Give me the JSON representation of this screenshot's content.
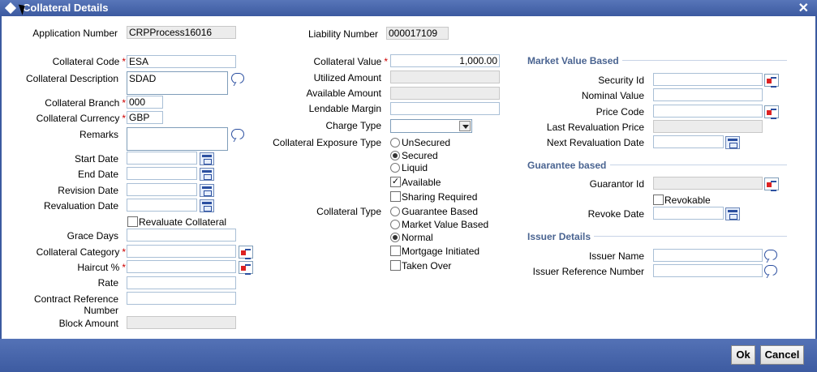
{
  "window": {
    "title": "Collateral Details",
    "close_glyph": "✕"
  },
  "left": {
    "application_number": {
      "label": "Application Number",
      "value": "CRPProcess16016"
    },
    "collateral_code": {
      "label": "Collateral Code",
      "value": "ESA"
    },
    "collateral_description": {
      "label": "Collateral Description",
      "value": "SDAD"
    },
    "collateral_branch": {
      "label": "Collateral Branch",
      "value": "000"
    },
    "collateral_currency": {
      "label": "Collateral Currency",
      "value": "GBP"
    },
    "remarks": {
      "label": "Remarks",
      "value": ""
    },
    "start_date": {
      "label": "Start Date",
      "value": ""
    },
    "end_date": {
      "label": "End Date",
      "value": ""
    },
    "revision_date": {
      "label": "Revision Date",
      "value": ""
    },
    "revaluation_date": {
      "label": "Revaluation Date",
      "value": ""
    },
    "revaluate_collateral": {
      "label": "Revaluate Collateral",
      "checked": false
    },
    "grace_days": {
      "label": "Grace Days",
      "value": ""
    },
    "collateral_category": {
      "label": "Collateral Category",
      "value": ""
    },
    "haircut": {
      "label": "Haircut %",
      "value": ""
    },
    "rate": {
      "label": "Rate",
      "value": ""
    },
    "contract_reference_number": {
      "label_line1": "Contract Reference",
      "label_line2": "Number",
      "value": ""
    },
    "block_amount": {
      "label": "Block Amount",
      "value": ""
    },
    "required_mark": "*"
  },
  "middle": {
    "liability_number": {
      "label": "Liability Number",
      "value": "000017109"
    },
    "collateral_value": {
      "label": "Collateral Value",
      "value": "1,000.00"
    },
    "utilized_amount": {
      "label": "Utilized Amount",
      "value": ""
    },
    "available_amount": {
      "label": "Available Amount",
      "value": ""
    },
    "lendable_margin": {
      "label": "Lendable Margin",
      "value": ""
    },
    "charge_type": {
      "label": "Charge Type",
      "value": ""
    },
    "exposure_type": {
      "label": "Collateral Exposure Type",
      "options": [
        "UnSecured",
        "Secured",
        "Liquid"
      ],
      "selected": "Secured"
    },
    "available": {
      "label": "Available",
      "checked": true
    },
    "sharing_required": {
      "label": "Sharing Required",
      "checked": false
    },
    "collateral_type": {
      "label": "Collateral Type",
      "options": [
        "Guarantee Based",
        "Market Value Based",
        "Normal"
      ],
      "selected": "Normal"
    },
    "mortgage_initiated": {
      "label": "Mortgage Initiated",
      "checked": false
    },
    "taken_over": {
      "label": "Taken Over",
      "checked": false
    },
    "check_glyph": "✓"
  },
  "right": {
    "market_value_based": {
      "heading": "Market Value Based",
      "security_id": {
        "label": "Security Id",
        "value": ""
      },
      "nominal_value": {
        "label": "Nominal Value",
        "value": ""
      },
      "price_code": {
        "label": "Price Code",
        "value": ""
      },
      "last_revaluation_price": {
        "label": "Last Revaluation Price",
        "value": ""
      },
      "next_revaluation_date": {
        "label": "Next Revaluation Date",
        "value": ""
      }
    },
    "guarantee_based": {
      "heading": "Guarantee based",
      "guarantor_id": {
        "label": "Guarantor Id",
        "value": ""
      },
      "revokable": {
        "label": "Revokable",
        "checked": false
      },
      "revoke_date": {
        "label": "Revoke Date",
        "value": ""
      }
    },
    "issuer_details": {
      "heading": "Issuer Details",
      "issuer_name": {
        "label": "Issuer Name",
        "value": ""
      },
      "issuer_reference_number": {
        "label": "Issuer Reference Number",
        "value": ""
      }
    }
  },
  "footer": {
    "ok_label": "Ok",
    "cancel_label": "Cancel"
  },
  "colors": {
    "titlebar": "#3c5aa0",
    "section_heading": "#4a6491",
    "required": "#cc0000"
  }
}
